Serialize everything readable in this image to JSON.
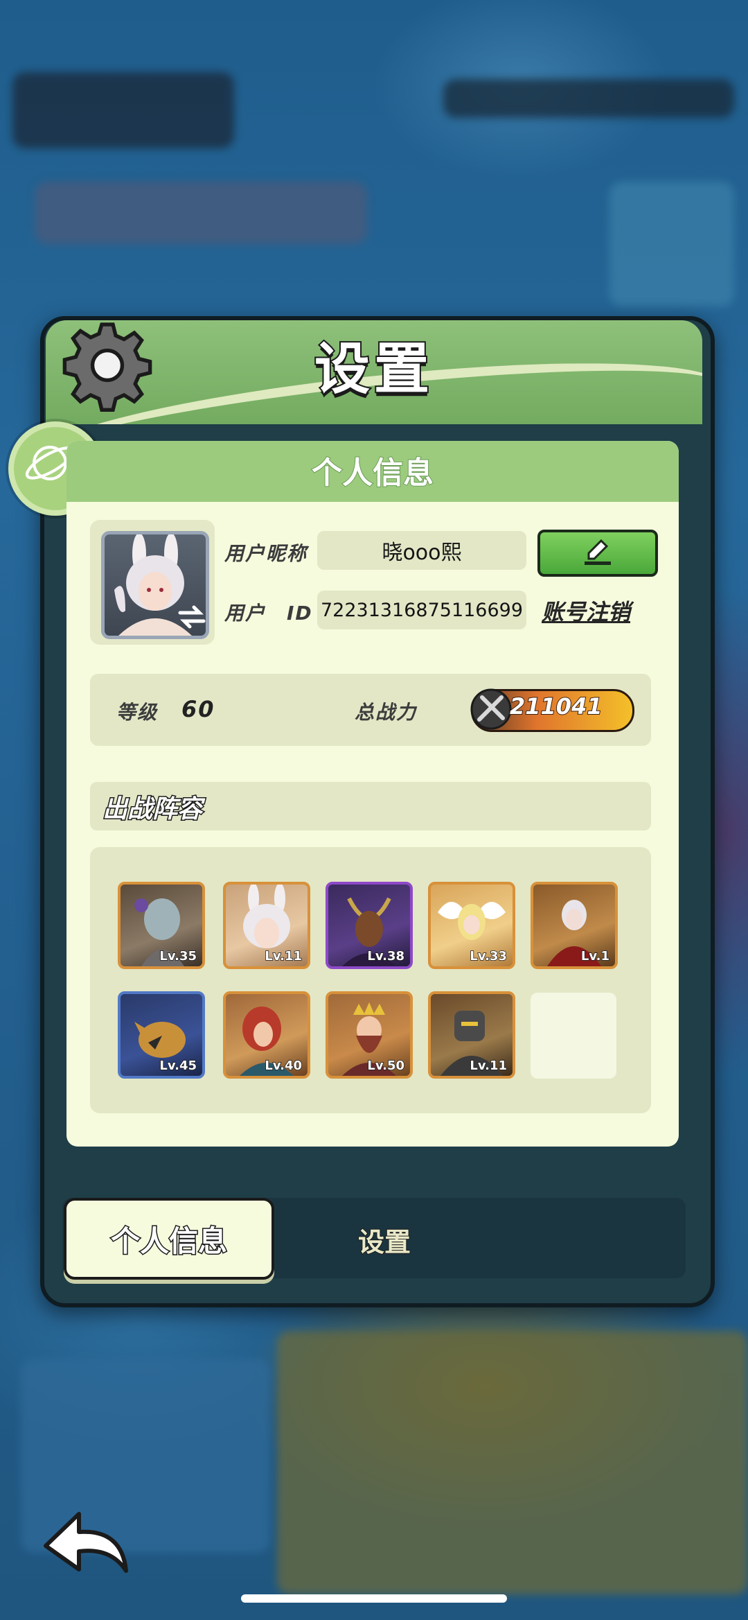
{
  "settings_panel": {
    "title": "设置"
  },
  "personal_info": {
    "header": "个人信息",
    "nickname_label": "用户昵称",
    "nickname": "晓ooo熙",
    "id_label": "用户　ID",
    "user_id": "72231316875116699",
    "logout_label": "账号注销"
  },
  "stats": {
    "level_label": "等级",
    "level": "60",
    "power_label": "总战力",
    "power": "211041"
  },
  "lineup": {
    "title": "出战阵容",
    "heroes": [
      {
        "level": "Lv.35",
        "rarity": "legendary",
        "icon": "squid-mage-hero"
      },
      {
        "level": "Lv.11",
        "rarity": "legendary",
        "icon": "bunny-girl-hero"
      },
      {
        "level": "Lv.38",
        "rarity": "epic",
        "icon": "horned-dark-hero"
      },
      {
        "level": "Lv.33",
        "rarity": "legendary",
        "icon": "angel-hero"
      },
      {
        "level": "Lv.1",
        "rarity": "legendary",
        "icon": "vampire-hero"
      },
      {
        "level": "Lv.45",
        "rarity": "rare",
        "icon": "beast-hero"
      },
      {
        "level": "Lv.40",
        "rarity": "legendary",
        "icon": "red-hair-hero"
      },
      {
        "level": "Lv.50",
        "rarity": "legendary",
        "icon": "king-hero"
      },
      {
        "level": "Lv.11",
        "rarity": "legendary",
        "icon": "armored-knight-hero"
      }
    ]
  },
  "tabs": {
    "personal_info": "个人信息",
    "settings": "设置"
  },
  "colors": {
    "header_green": "#8ec07a",
    "card_bg": "#f6fbde",
    "field_bg": "#e3e7c6",
    "legendary_border": "#d8913a",
    "epic_border": "#8d49c8",
    "rare_border": "#5179c6"
  }
}
